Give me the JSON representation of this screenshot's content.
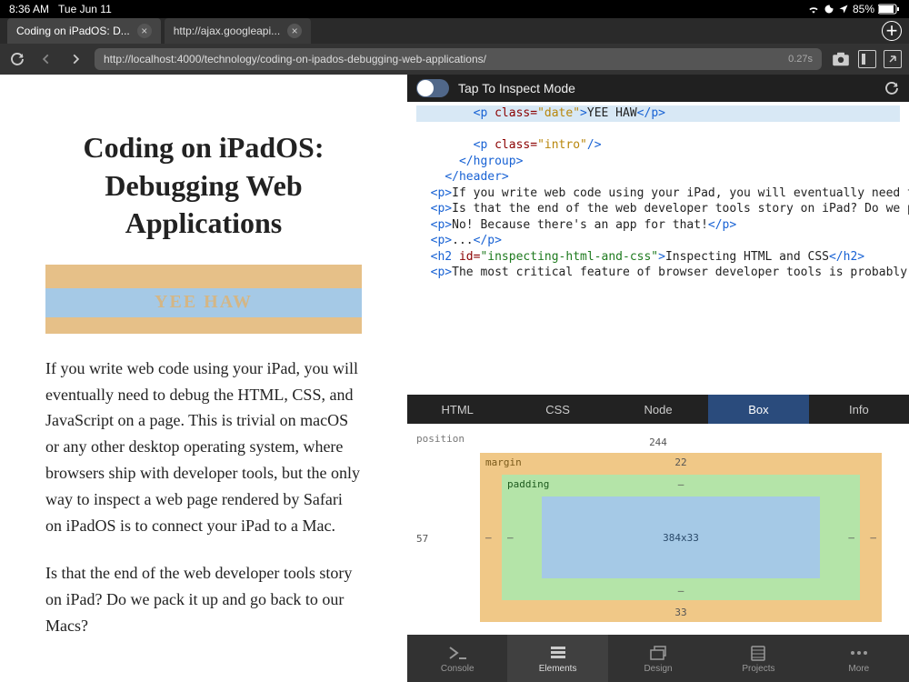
{
  "status": {
    "time": "8:36 AM",
    "date": "Tue Jun 11",
    "battery_pct": "85%"
  },
  "tabs": [
    {
      "title": "Coding on iPadOS: D...",
      "active": true
    },
    {
      "title": "http://ajax.googleapi...",
      "active": false
    }
  ],
  "url": {
    "text": "http://localhost:4000/technology/coding-on-ipados-debugging-web-applications/",
    "load_time": "0.27s"
  },
  "article": {
    "title": "Coding on iPadOS: Debugging Web Applications",
    "banner_text": "YEE HAW",
    "p1": "If you write web code using your iPad, you will eventually need to debug the HTML, CSS, and JavaScript on a page. This is trivial on macOS or any other desktop operating system, where browsers ship with developer tools, but the only way to inspect a web page rendered by Safari on iPadOS is to connect your iPad to a Mac.",
    "p2": "Is that the end of the web developer tools story on iPad? Do we pack it up and go back to our Macs?"
  },
  "inspector": {
    "toggle_label": "Tap To Inspect Mode",
    "detail_tabs": [
      "HTML",
      "CSS",
      "Node",
      "Box",
      "Info"
    ],
    "active_detail_tab": "Box",
    "source_text": {
      "hl_text": "YEE HAW",
      "para1": "If you write web code using your iPad, you will eventually need to debug the HTML, CSS, and JavaScript on a page. This is trivial on macOS or any other desktop operating system, where browsers ship with developer tools, but the only way to inspect a web page rendered by Safari on iPadOS is to connect your iPad to a Mac.",
      "para2": "Is that the end of the web developer tools story on iPad? Do we pack it up and go back to our Macs?",
      "para3": "No! Because there's an app for that!",
      "para4": "...",
      "h2_id": "inspecting-html-and-css",
      "h2_text": "Inspecting HTML and CSS",
      "para5": "The most critical feature of browser developer tools is probably HTML and CSS inspection. As a developer, I want to point t"
    },
    "box_model": {
      "position_label": "position",
      "position_top": "244",
      "position_left": "57",
      "margin_label": "margin",
      "margin_top": "22",
      "margin_bottom": "33",
      "margin_left": "–",
      "margin_right": "–",
      "padding_label": "padding",
      "padding_top": "–",
      "padding_bottom": "–",
      "padding_left": "–",
      "padding_right": "–",
      "content": "384x33"
    }
  },
  "bottom_nav": [
    {
      "label": "Console"
    },
    {
      "label": "Elements"
    },
    {
      "label": "Design"
    },
    {
      "label": "Projects"
    },
    {
      "label": "More"
    }
  ],
  "bottom_nav_active": "Elements"
}
